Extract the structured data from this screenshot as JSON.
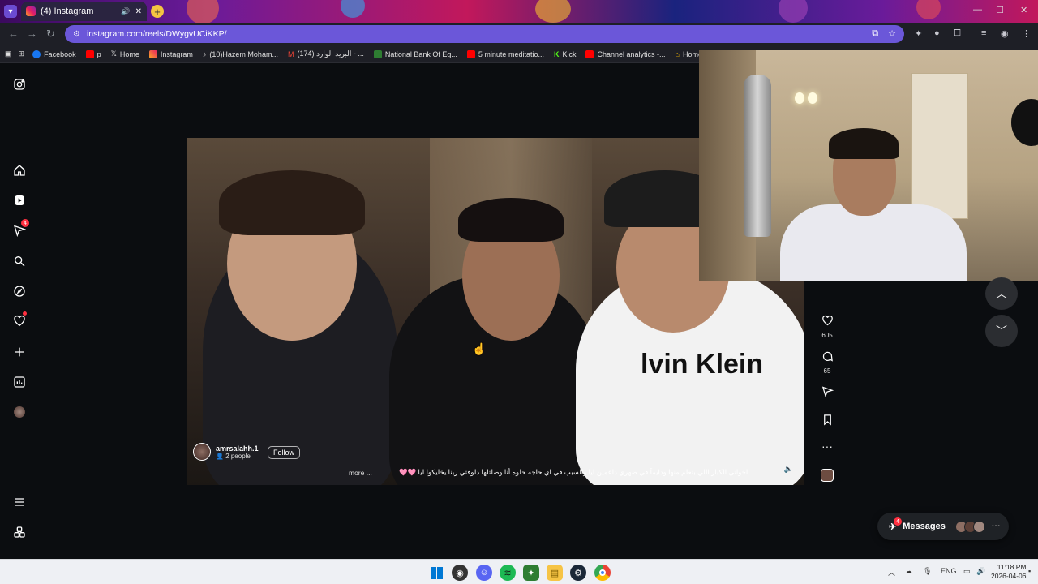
{
  "browser": {
    "tab_title": "(4) Instagram",
    "url": "instagram.com/reels/DWygvUCiKKP/",
    "bookmarks": [
      {
        "label": "Facebook",
        "color": "#1877f2"
      },
      {
        "label": "p",
        "color": "#ff0000"
      },
      {
        "label": "Home",
        "color": "#ffffff"
      },
      {
        "label": "Instagram",
        "color": "#e1306c"
      },
      {
        "label": "(10)Hazem Moham...",
        "color": "#ffffff"
      },
      {
        "label": "(174) البريد الوارد - ...",
        "color": "#ea4335"
      },
      {
        "label": "National Bank Of Eg...",
        "color": "#2e7d32"
      },
      {
        "label": "5 minute meditatio...",
        "color": "#ff0000"
      },
      {
        "label": "Kick",
        "color": "#53fc18"
      },
      {
        "label": "Channel analytics -...",
        "color": "#ff0000"
      },
      {
        "label": "Home – G",
        "color": "#fbbc04"
      }
    ]
  },
  "sidebar": {
    "notifications_badge": "4",
    "icons": [
      "instagram-logo-icon",
      "home-icon",
      "reels-icon",
      "messages-icon",
      "search-icon",
      "explore-icon",
      "notifications-icon",
      "create-icon",
      "dashboard-icon",
      "profile-avatar",
      "more-icon",
      "meta-icon"
    ]
  },
  "reel": {
    "username": "amrsalahh.1",
    "people": "2 people",
    "follow_label": "Follow",
    "caption": "اخواتي الكبار اللي بتعلم منها ودايماً في ضهري داعمين ليا والسبب في اي حاجه حلوه أنا وصلتلها دلوقتي ربنا يخليكوا ليا 🩷🩷",
    "more_label": "more ...",
    "likes": "605",
    "comments": "65"
  },
  "messages": {
    "label": "Messages",
    "badge": "4"
  },
  "taskbar": {
    "language": "ENG",
    "time": "11:18 PM",
    "date": "2026-04-06"
  },
  "colors": {
    "accent_omnibox": "#6b57d9",
    "badge_red": "#ff3040"
  }
}
